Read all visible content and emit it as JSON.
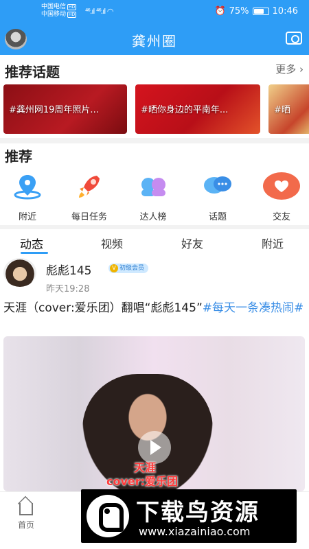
{
  "status_bar": {
    "carrier1": "中国电信",
    "carrier2": "中国移动",
    "hd": "HD",
    "signal1": "⁴⁶.ıl",
    "signal2": "⁴⁶.ıl",
    "battery": "75%",
    "time": "10:46"
  },
  "header": {
    "title": "龚州圈"
  },
  "topics_section": {
    "title": "推荐话题",
    "more": "更多"
  },
  "topics": [
    {
      "text": "#龚州网19周年照片...",
      "color": "#a3141c"
    },
    {
      "text": "#晒你身边的平南年...",
      "color": "#c8131c"
    },
    {
      "text": "#晒",
      "color": "#e5c46c"
    }
  ],
  "recommend_section": {
    "title": "推荐"
  },
  "recommend_items": [
    {
      "label": "附近"
    },
    {
      "label": "每日任务"
    },
    {
      "label": "达人榜"
    },
    {
      "label": "话题"
    },
    {
      "label": "交友"
    }
  ],
  "feed_tabs": [
    {
      "label": "动态",
      "active": true
    },
    {
      "label": "视频"
    },
    {
      "label": "好友"
    },
    {
      "label": "附近"
    }
  ],
  "post": {
    "username": "彪彪145",
    "badge": "初级会员",
    "time": "昨天19:28",
    "text": "天涯（cover:爱乐团）翻唱“彪彪145”",
    "tag": "#每天一条凑热闹#",
    "video_caption1": "天涯",
    "video_caption2": "cover:爱乐团"
  },
  "bottom_nav": {
    "home": "首页"
  },
  "watermark": {
    "title": "下载鸟资源",
    "url": "www.xiazainiao.com"
  }
}
